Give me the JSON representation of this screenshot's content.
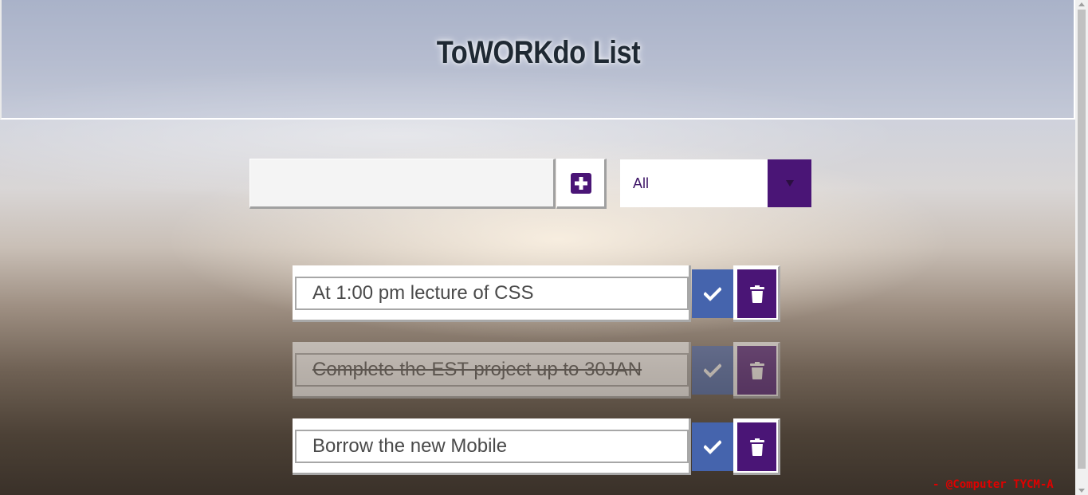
{
  "header": {
    "title": "ToWORKdo List"
  },
  "form": {
    "input_value": "",
    "input_placeholder": "",
    "add_icon": "plus-square-icon",
    "filter": {
      "selected": "All",
      "arrow_icon": "caret-down-icon"
    }
  },
  "todos": [
    {
      "text": "At 1:00 pm lecture of CSS",
      "completed": false
    },
    {
      "text": "Complete the EST project up to 30JAN",
      "completed": true
    },
    {
      "text": "Borrow the new Mobile",
      "completed": false
    }
  ],
  "watermark": "- @Computer TYCM-A",
  "colors": {
    "accent_purple": "#4a1576",
    "check_blue": "#4564ad",
    "watermark_red": "#e00000"
  }
}
